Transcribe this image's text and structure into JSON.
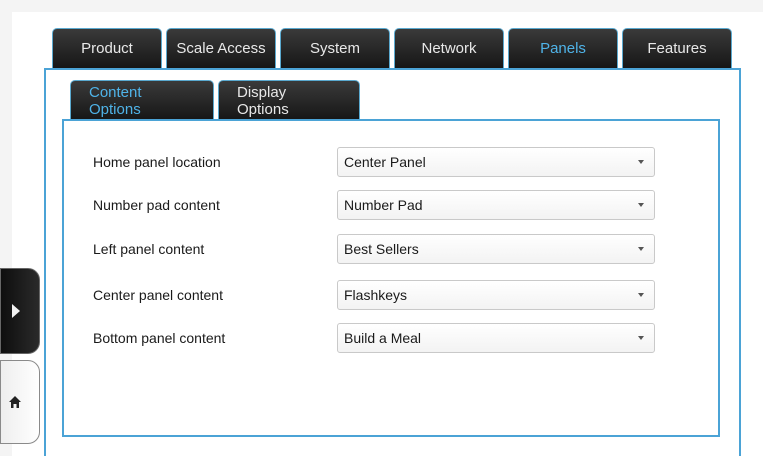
{
  "top_tabs": [
    {
      "label": "Product"
    },
    {
      "label": "Scale Access"
    },
    {
      "label": "System"
    },
    {
      "label": "Network"
    },
    {
      "label": "Panels"
    },
    {
      "label": "Features"
    }
  ],
  "active_top_tab": "Panels",
  "sub_tabs": [
    {
      "label": "Content Options"
    },
    {
      "label": "Display Options"
    }
  ],
  "active_sub_tab": "Content Options",
  "settings": [
    {
      "label": "Home panel location",
      "value": "Center Panel"
    },
    {
      "label": "Number pad content",
      "value": "Number Pad"
    },
    {
      "label": "Left panel content",
      "value": "Best Sellers"
    },
    {
      "label": "Center panel content",
      "value": "Flashkeys"
    },
    {
      "label": "Bottom panel content",
      "value": "Build a Meal"
    }
  ],
  "side_controls": {
    "expand_icon": "play-right-icon",
    "home_icon": "home-icon"
  },
  "colors": {
    "accent": "#4ba3d6",
    "active_tab_text": "#4fb3e8",
    "tab_background": "#1e1e1e"
  }
}
